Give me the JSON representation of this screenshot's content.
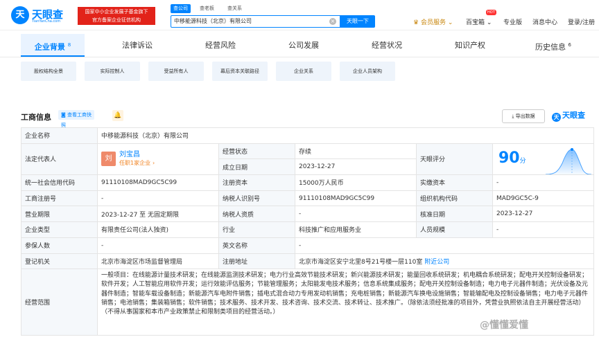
{
  "header": {
    "logo_mark": "天",
    "logo_text": "天眼查",
    "logo_sub": "TianYanCha.com",
    "promo_line1": "国家中小企业发展子基金旗下",
    "promo_line2": "官方备案企业征信机构",
    "search_tabs": [
      "查公司",
      "查老板",
      "查关系"
    ],
    "search_value": "中移能源科技（北京）有限公司",
    "search_button": "天眼一下",
    "nav": {
      "vip": "会员服务",
      "box": "百宝箱",
      "hot": "HOT",
      "pro": "专业版",
      "msg": "消息中心",
      "login": "登录/注册"
    }
  },
  "tabs": [
    {
      "label": "企业背景",
      "count": "8"
    },
    {
      "label": "法律诉讼",
      "count": ""
    },
    {
      "label": "经营风险",
      "count": ""
    },
    {
      "label": "公司发展",
      "count": ""
    },
    {
      "label": "经营状况",
      "count": ""
    },
    {
      "label": "知识产权",
      "count": ""
    },
    {
      "label": "历史信息",
      "count": "6"
    }
  ],
  "sub_buttons": [
    "股权结构全景",
    "实际控制人",
    "受益所有人",
    "幕后资本关联路径",
    "企业关系",
    "企业人员架构"
  ],
  "section": {
    "title": "工商信息",
    "chip": "查看工商快",
    "chip2": "照",
    "export": "导出数据",
    "brand": "天眼查"
  },
  "info": {
    "company_name_label": "企业名称",
    "company_name": "中移能源科技（北京）有限公司",
    "legal_rep_label": "法定代表人",
    "legal_rep_avatar": "刘",
    "legal_rep_name": "刘宝昌",
    "legal_rep_sub": "任职1家企业",
    "status_label": "经营状态",
    "status": "存续",
    "est_date_label": "成立日期",
    "est_date": "2023-12-27",
    "score_label": "天眼评分",
    "score": "90",
    "score_unit": "分",
    "credit_code_label": "统一社会信用代码",
    "credit_code": "91110108MAD9GC5C99",
    "reg_capital_label": "注册资本",
    "reg_capital": "15000万人民币",
    "paid_capital_label": "实缴资本",
    "paid_capital": "-",
    "reg_no_label": "工商注册号",
    "reg_no": "-",
    "tax_id_label": "纳税人识别号",
    "tax_id": "91110108MAD9GC5C99",
    "org_code_label": "组织机构代码",
    "org_code": "MAD9GC5C-9",
    "term_label": "营业期限",
    "term": "2023-12-27 至 无固定期限",
    "taxpayer_label": "纳税人资质",
    "taxpayer": "-",
    "approve_label": "核准日期",
    "approve": "2023-12-27",
    "type_label": "企业类型",
    "type": "有限责任公司(法人独资)",
    "industry_label": "行业",
    "industry": "科技推广和应用服务业",
    "staff_label": "人员规模",
    "staff": "-",
    "insured_label": "参保人数",
    "insured": "-",
    "en_name_label": "英文名称",
    "en_name": "-",
    "authority_label": "登记机关",
    "authority": "北京市海淀区市场监督管理局",
    "address_label": "注册地址",
    "address": "北京市海淀区安宁北里8号21号楼一层110室",
    "nearby": "附近公司",
    "scope_label": "经营范围",
    "scope": "一般项目：在线能源计量技术研发；在线能源监测技术研发；电力行业高效节能技术研发；新兴能源技术研发；能量回收系统研发；机电耦合系统研发；配电开关控制设备研发；软件开发；人工智能应用软件开发；运行效能评估服务；节能管理服务；太阳能发电技术服务；信息系统集成服务；配电开关控制设备制造；电力电子元器件制造；光伏设备及元器件制造；智能车载设备制造；新能源汽车电附件销售；插电式混合动力专用发动机销售；充电桩销售；新能源汽车换电设施销售；智能输配电及控制设备销售；电力电子元器件销售；电池销售；集装箱销售；软件销售；技术服务、技术开发、技术咨询、技术交流、技术转让、技术推广。（除依法须经批准的项目外，凭营业执照依法自主开展经营活动）（不得从事国家和本市产业政策禁止和限制类项目的经营活动。）"
  },
  "watermark": "@懂懂爱懂",
  "colors": {
    "brand": "#0084ff",
    "status_green": "#20a53a",
    "promo_red": "#e2231a"
  }
}
